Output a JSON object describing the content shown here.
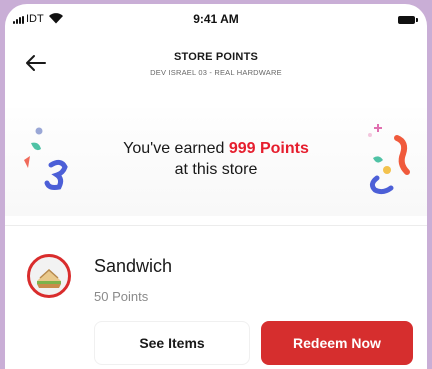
{
  "status_bar": {
    "carrier": "IDT",
    "time": "9:41 AM"
  },
  "header": {
    "title": "STORE POINTS",
    "subtitle": "DEV ISRAEL 03 - REAL HARDWARE",
    "back_icon": "arrow-left-icon"
  },
  "banner": {
    "prefix": "You've earned ",
    "points": "999 Points",
    "suffix": "at this store",
    "accent_color": "#e61e2e"
  },
  "reward": {
    "name": "Sandwich",
    "points": "50 Points",
    "icon": "sandwich-icon"
  },
  "buttons": {
    "see_items": "See Items",
    "redeem": "Redeem Now",
    "redeem_color": "#d62e2e"
  }
}
